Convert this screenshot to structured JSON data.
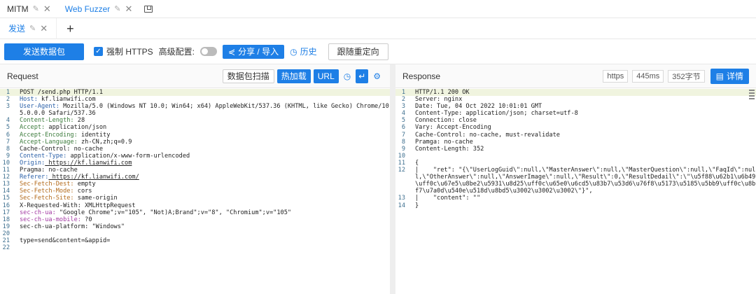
{
  "top_tabs": [
    {
      "label": "MITM",
      "active": false
    },
    {
      "label": "Web Fuzzer",
      "active": true
    }
  ],
  "sub_tabs": [
    {
      "label": "发送"
    }
  ],
  "toolbar": {
    "send_label": "发送数据包",
    "https_label": "强制 HTTPS",
    "advanced_label": "高级配置:",
    "share_label": "分享 / 导入",
    "history_label": "历史",
    "redirect_label": "跟随重定向"
  },
  "request": {
    "title": "Request",
    "buttons": {
      "scan": "数据包扫描",
      "hotload": "热加载",
      "url": "URL"
    },
    "lines": [
      {
        "n": "1",
        "name": "",
        "text": "POST /send.php HTTP/1.1",
        "hl": true
      },
      {
        "n": "2",
        "name": "Host:",
        "text": " kf.lianwifi.com",
        "style": "k-blue"
      },
      {
        "n": "3",
        "name": "User-Agent:",
        "text": " Mozilla/5.0 (Windows NT 10.0; Win64; x64) AppleWebKit/537.36 (KHTML, like Gecko) Chrome/105.0.0.0 Safari/537.36",
        "style": "k-blue"
      },
      {
        "n": "4",
        "name": "Content-Length:",
        "text": " 28",
        "style": "k-green"
      },
      {
        "n": "5",
        "name": "Accept:",
        "text": " application/json",
        "style": "k-green"
      },
      {
        "n": "6",
        "name": "Accept-Encoding:",
        "text": " identity",
        "style": "k-green"
      },
      {
        "n": "7",
        "name": "Accept-Language:",
        "text": " zh-CN,zh;q=0.9",
        "style": "k-green"
      },
      {
        "n": "8",
        "name": "",
        "text": "Cache-Control: no-cache"
      },
      {
        "n": "9",
        "name": "Content-Type:",
        "text": " application/x-www-form-urlencoded",
        "style": "k-blue"
      },
      {
        "n": "10",
        "name": "Origin:",
        "text": " https://kf.lianwifi.com",
        "style": "k-blue",
        "underline": true
      },
      {
        "n": "11",
        "name": "",
        "text": "Pragma: no-cache"
      },
      {
        "n": "12",
        "name": "Referer:",
        "text": " https://kf.lianwifi.com/",
        "style": "k-blue",
        "underline": true
      },
      {
        "n": "13",
        "name": "Sec-Fetch-Dest:",
        "text": " empty",
        "style": "k-orange"
      },
      {
        "n": "14",
        "name": "Sec-Fetch-Mode:",
        "text": " cors",
        "style": "k-orange"
      },
      {
        "n": "15",
        "name": "Sec-Fetch-Site:",
        "text": " same-origin",
        "style": "k-orange"
      },
      {
        "n": "16",
        "name": "",
        "text": "X-Requested-With: XMLHttpRequest"
      },
      {
        "n": "17",
        "name": "sec-ch-ua:",
        "text": " \"Google Chrome\";v=\"105\", \"Not)A;Brand\";v=\"8\", \"Chromium\";v=\"105\"",
        "style": "k-purple"
      },
      {
        "n": "18",
        "name": "sec-ch-ua-mobile:",
        "text": " ?0",
        "style": "k-purple"
      },
      {
        "n": "19",
        "name": "",
        "text": "sec-ch-ua-platform: \"Windows\""
      },
      {
        "n": "20",
        "name": "",
        "text": ""
      },
      {
        "n": "21",
        "name": "",
        "text": "type=send&content=&appid="
      },
      {
        "n": "22",
        "name": "",
        "text": ""
      }
    ]
  },
  "response": {
    "title": "Response",
    "tags": {
      "proto": "https",
      "time": "445ms",
      "size": "352字节"
    },
    "detail_label": "详情",
    "lines": [
      {
        "n": "1",
        "text": "HTTP/1.1 200 OK",
        "hl": true
      },
      {
        "n": "2",
        "text": "Server: nginx"
      },
      {
        "n": "3",
        "text": "Date: Tue, 04 Oct 2022 10:01:01 GMT"
      },
      {
        "n": "4",
        "text": "Content-Type: application/json; charset=utf-8"
      },
      {
        "n": "5",
        "text": "Connection: close"
      },
      {
        "n": "6",
        "text": "Vary: Accept-Encoding"
      },
      {
        "n": "7",
        "text": "Cache-Control: no-cache, must-revalidate"
      },
      {
        "n": "8",
        "text": "Pramga: no-cache"
      },
      {
        "n": "9",
        "text": "Content-Length: 352"
      },
      {
        "n": "10",
        "text": ""
      },
      {
        "n": "11",
        "text": "{"
      },
      {
        "n": "12",
        "text": "|    \"ret\": \"{\\\"UserLogGuid\\\":null,\\\"MasterAnswer\\\":null,\\\"MasterQuestion\\\":null,\\\"FaqId\\\":null,\\\"OtherAnswer\\\":null,\\\"AnswerImage\\\":null,\\\"Result\\\":0,\\\"ResultDedail\\\":\\\"\\u5f88\\u62b1\\u6b49\\uff0c\\u67e5\\u8be2\\u5931\\u8d25\\uff0c\\u65e0\\u6cd5\\u83b7\\u53d6\\u76f8\\u5173\\u5185\\u5bb9\\uff0c\\u8bf7\\u7a0d\\u540e\\u518d\\u8bd5\\u3002\\u3002\\u3002\\\"}\","
      },
      {
        "n": "13",
        "text": "|    \"content\": \"\""
      },
      {
        "n": "14",
        "text": "}"
      }
    ]
  }
}
